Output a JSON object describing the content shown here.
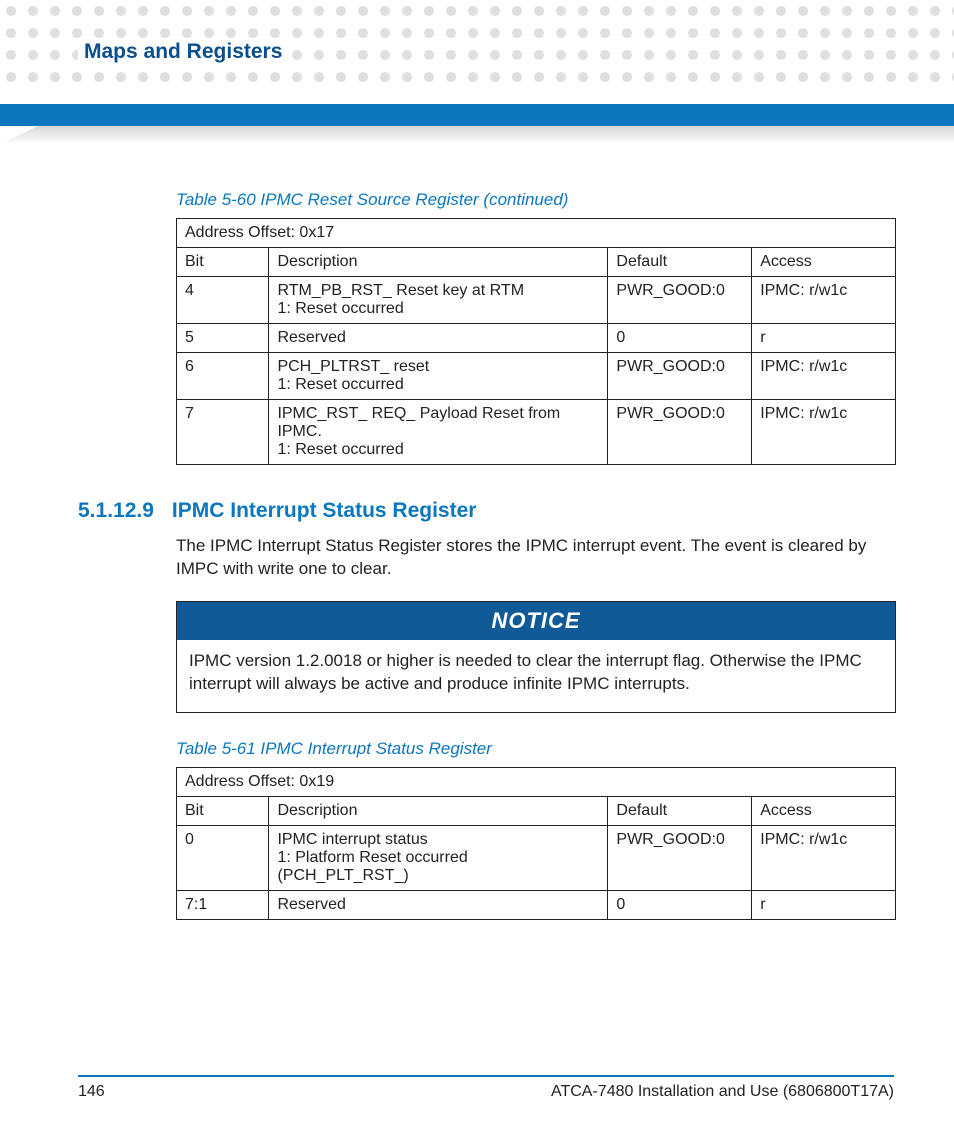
{
  "header": {
    "title": "Maps and Registers"
  },
  "table1": {
    "caption": "Table 5-60 IPMC Reset Source Register (continued)",
    "offset": "Address Offset: 0x17",
    "cols": {
      "bit": "Bit",
      "desc": "Description",
      "def": "Default",
      "acc": "Access"
    },
    "rows": [
      {
        "bit": "4",
        "desc_l1": "RTM_PB_RST_ Reset key at RTM",
        "desc_l2": "1: Reset occurred",
        "def": "PWR_GOOD:0",
        "acc": "IPMC: r/w1c"
      },
      {
        "bit": "5",
        "desc_l1": "Reserved",
        "desc_l2": "",
        "def": "0",
        "acc": "r"
      },
      {
        "bit": "6",
        "desc_l1": "PCH_PLTRST_ reset",
        "desc_l2": "1: Reset occurred",
        "def": "PWR_GOOD:0",
        "acc": "IPMC: r/w1c"
      },
      {
        "bit": "7",
        "desc_l1": "IPMC_RST_ REQ_ Payload Reset from IPMC.",
        "desc_l2": "1: Reset occurred",
        "def": "PWR_GOOD:0",
        "acc": "IPMC: r/w1c"
      }
    ]
  },
  "section": {
    "num": "5.1.12.9",
    "title": "IPMC Interrupt Status Register",
    "para": "The IPMC Interrupt Status Register stores the IPMC interrupt event. The event is cleared by IMPC with write one to clear."
  },
  "notice": {
    "label": "NOTICE",
    "body": "IPMC version 1.2.0018 or higher is needed to clear the interrupt flag. Otherwise the IPMC interrupt will always be active and produce infinite IPMC interrupts."
  },
  "table2": {
    "caption": "Table 5-61 IPMC Interrupt Status Register",
    "offset": "Address Offset: 0x19",
    "cols": {
      "bit": "Bit",
      "desc": "Description",
      "def": "Default",
      "acc": "Access"
    },
    "rows": [
      {
        "bit": "0",
        "desc_l1": "IPMC interrupt status",
        "desc_l2": "1: Platform Reset occurred (PCH_PLT_RST_)",
        "def": "PWR_GOOD:0",
        "acc": "IPMC: r/w1c"
      },
      {
        "bit": "7:1",
        "desc_l1": "Reserved",
        "desc_l2": "",
        "def": "0",
        "acc": "r"
      }
    ]
  },
  "footer": {
    "page": "146",
    "doc": "ATCA-7480 Installation and Use (6806800T17A)"
  }
}
